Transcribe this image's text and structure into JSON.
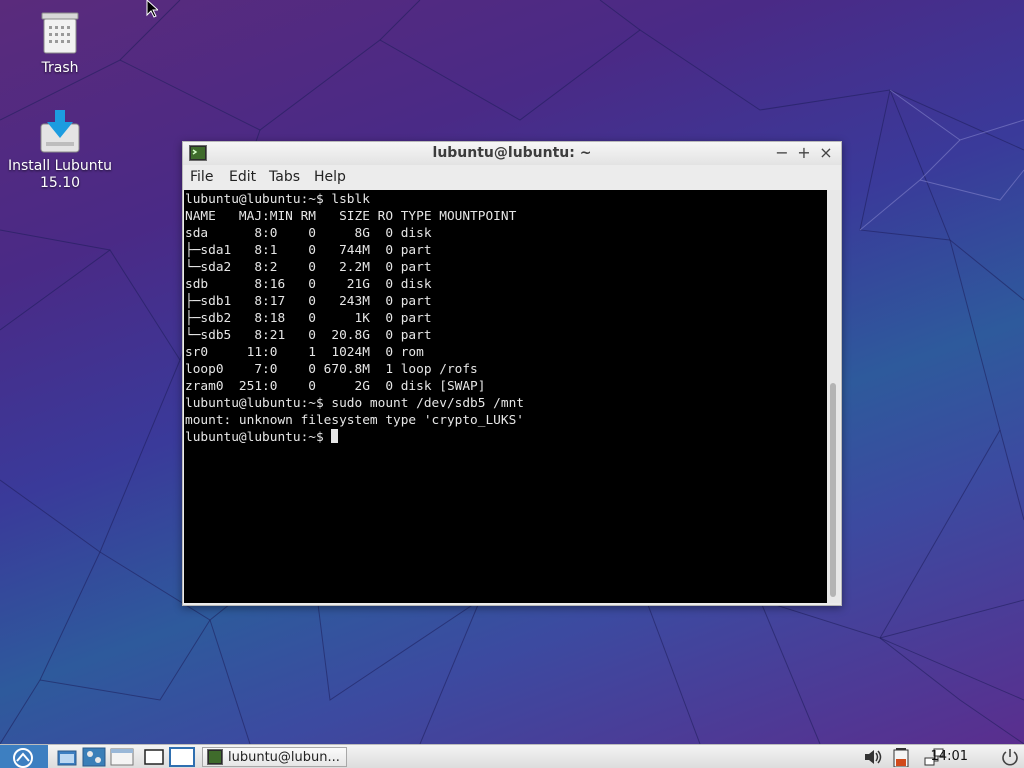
{
  "desktop": {
    "icons": [
      {
        "label": "Trash"
      },
      {
        "label": "Install Lubuntu 15.10"
      }
    ]
  },
  "terminal": {
    "title": "lubuntu@lubuntu: ~",
    "menu": [
      "File",
      "Edit",
      "Tabs",
      "Help"
    ],
    "lines": [
      "lubuntu@lubuntu:~$ lsblk",
      "NAME   MAJ:MIN RM   SIZE RO TYPE MOUNTPOINT",
      "sda      8:0    0     8G  0 disk",
      "├─sda1   8:1    0   744M  0 part",
      "└─sda2   8:2    0   2.2M  0 part",
      "sdb      8:16   0    21G  0 disk",
      "├─sdb1   8:17   0   243M  0 part",
      "├─sdb2   8:18   0     1K  0 part",
      "└─sdb5   8:21   0  20.8G  0 part",
      "sr0     11:0    1  1024M  0 rom",
      "loop0    7:0    0 670.8M  1 loop /rofs",
      "zram0  251:0    0     2G  0 disk [SWAP]",
      "lubuntu@lubuntu:~$ sudo mount /dev/sdb5 /mnt",
      "mount: unknown filesystem type 'crypto_LUKS'"
    ],
    "prompt": "lubuntu@lubuntu:~$ "
  },
  "taskbar": {
    "task_label": "lubuntu@lubun...",
    "clock": "14:01"
  },
  "colors": {
    "console_bg": "#000000",
    "console_fg": "#e6e6e6",
    "accent": "#3d7fc1"
  }
}
